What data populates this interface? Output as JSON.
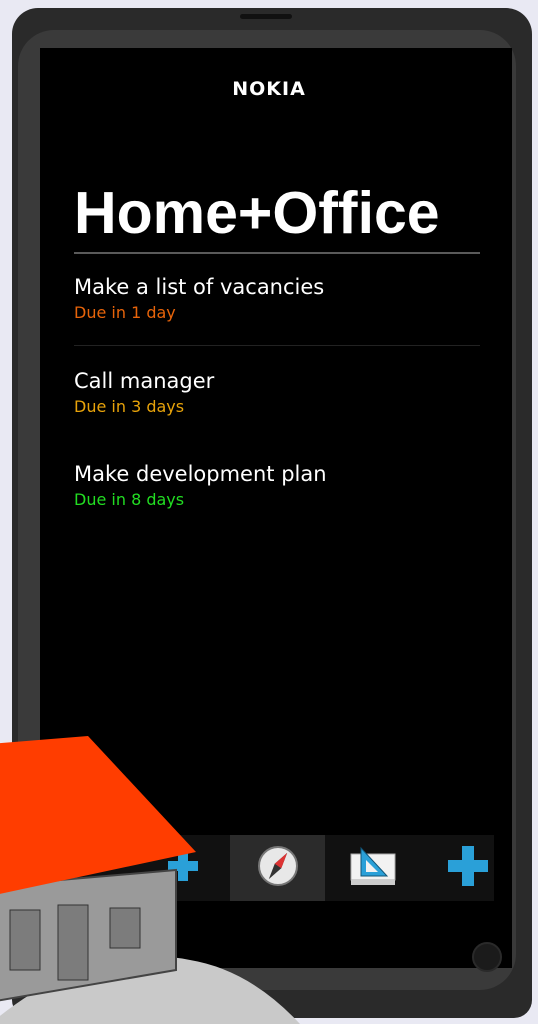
{
  "device": {
    "brand": "NOKIA"
  },
  "list": {
    "title": "Home+Office",
    "items": [
      {
        "name": "Make a list of vacancies",
        "due": "Due in 1 day",
        "color": "#e8640a"
      },
      {
        "name": "Call manager",
        "due": "Due in 3 days",
        "color": "#e8a30a"
      },
      {
        "name": "Make development plan",
        "due": "Due in 8 days",
        "color": "#22dd22"
      }
    ]
  },
  "toolbar": {
    "buttons": [
      {
        "icon": "add-icon"
      },
      {
        "icon": "compass-icon",
        "active": true
      },
      {
        "icon": "set-square-icon"
      },
      {
        "icon": "plus-icon"
      }
    ]
  },
  "colors": {
    "house_roof": "#ff3d00",
    "house_wall": "#9a9a9a",
    "toolbar_icon": "#2aa0d8"
  }
}
